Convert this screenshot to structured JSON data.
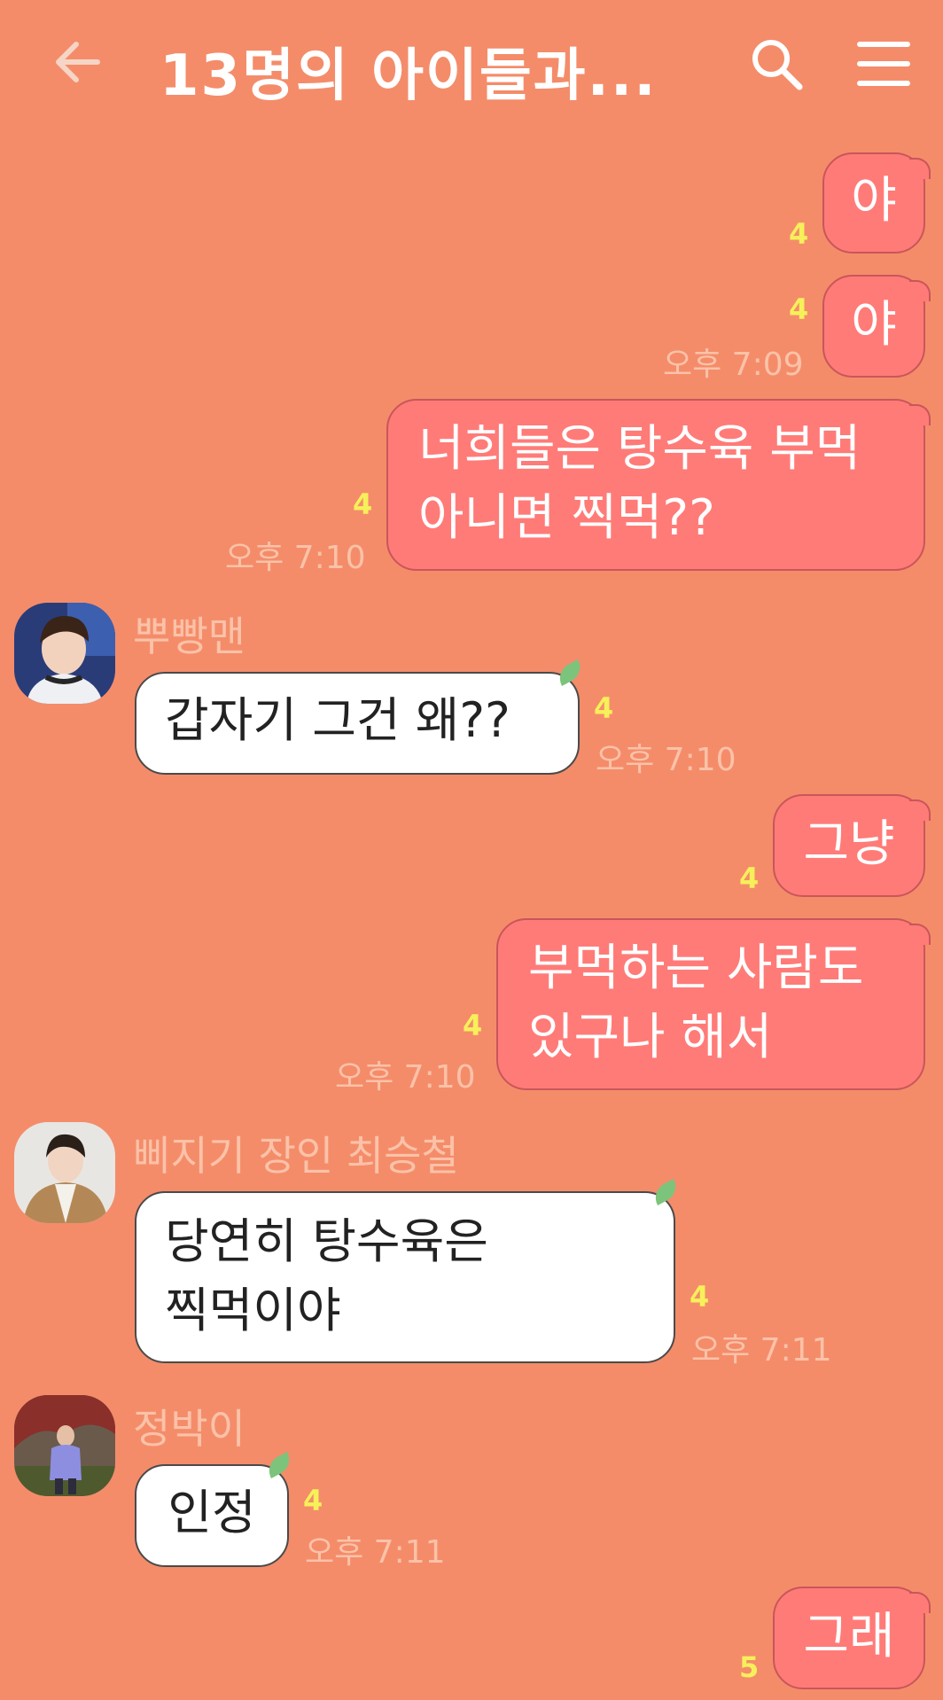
{
  "header": {
    "title": "13명의 아이들과...",
    "back_icon": "arrow-left-icon",
    "search_icon": "search-icon",
    "menu_icon": "hamburger-menu-icon"
  },
  "colors": {
    "background": "#f48c6a",
    "my_bubble": "#ff7b78",
    "their_bubble": "#ffffff",
    "unread_count": "#f6f05a",
    "timestamp": "#fbc2a8"
  },
  "messages": [
    {
      "from": "me",
      "text": "야",
      "unread": "4"
    },
    {
      "from": "me",
      "text": "야",
      "unread": "4",
      "time": "오후 7:09"
    },
    {
      "from": "me",
      "lines": [
        "너희들은 탕수육 부먹",
        "아니면 찍먹??"
      ],
      "unread": "4",
      "time": "오후 7:10"
    },
    {
      "from": "other",
      "sender": "뿌빵맨",
      "text": "갑자기 그건 왜??",
      "unread": "4",
      "time": "오후 7:10"
    },
    {
      "from": "me",
      "text": "그냥",
      "unread": "4"
    },
    {
      "from": "me",
      "lines": [
        "부먹하는 사람도",
        "있구나 해서"
      ],
      "unread": "4",
      "time": "오후 7:10"
    },
    {
      "from": "other",
      "sender": "삐지기 장인 최승철",
      "lines": [
        "당연히 탕수육은",
        "찍먹이야"
      ],
      "unread": "4",
      "time": "오후 7:11"
    },
    {
      "from": "other",
      "sender": "정박이",
      "text": "인정",
      "unread": "4",
      "time": "오후 7:11"
    },
    {
      "from": "me",
      "text": "그래",
      "unread": "5"
    }
  ]
}
